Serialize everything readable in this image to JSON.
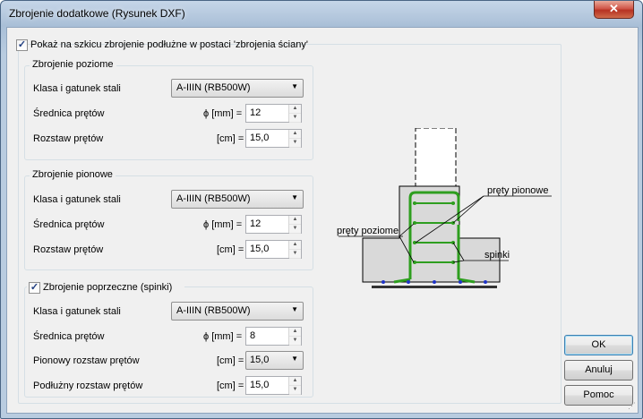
{
  "window": {
    "title": "Zbrojenie dodatkowe (Rysunek DXF)",
    "close_glyph": "✕"
  },
  "main_checkbox": {
    "label": "Pokaż na szkicu zbrojenie podłużne w postaci 'zbrojenia ściany'",
    "checked": true
  },
  "groups": {
    "horizontal": {
      "title": "Zbrojenie poziome",
      "steel_label": "Klasa i gatunek stali",
      "steel_value": "A-IIIN (RB500W)",
      "diameter_label": "Średnica prętów",
      "diameter_unit": "ϕ [mm]  =",
      "diameter_value": "12",
      "spacing_label": "Rozstaw prętów",
      "spacing_unit": "[cm]  =",
      "spacing_value": "15,0"
    },
    "vertical": {
      "title": "Zbrojenie pionowe",
      "steel_label": "Klasa i gatunek stali",
      "steel_value": "A-IIIN (RB500W)",
      "diameter_label": "Średnica prętów",
      "diameter_unit": "ϕ [mm]  =",
      "diameter_value": "12",
      "spacing_label": "Rozstaw prętów",
      "spacing_unit": "[cm]  =",
      "spacing_value": "15,0"
    },
    "transverse": {
      "title": "Zbrojenie poprzeczne (spinki)",
      "checked": true,
      "steel_label": "Klasa i gatunek stali",
      "steel_value": "A-IIIN (RB500W)",
      "diameter_label": "Średnica prętów",
      "diameter_unit": "ϕ [mm]  =",
      "diameter_value": "8",
      "vspacing_label": "Pionowy rozstaw prętów",
      "vspacing_unit": "[cm]  =",
      "vspacing_value": "15,0",
      "lspacing_label": "Podłużny rozstaw prętów",
      "lspacing_unit": "[cm]  =",
      "lspacing_value": "15,0"
    }
  },
  "sketch": {
    "label_vertical": "pręty pionowe",
    "label_horizontal": "pręty poziome",
    "label_spinki": "spinki",
    "bar_color": "#2e9e1f"
  },
  "buttons": {
    "ok": "OK",
    "cancel": "Anuluj",
    "help": "Pomoc"
  },
  "icons": {
    "dropdown": "▼",
    "up": "▲",
    "down": "▼",
    "check": "✓",
    "grip": "⋰"
  }
}
